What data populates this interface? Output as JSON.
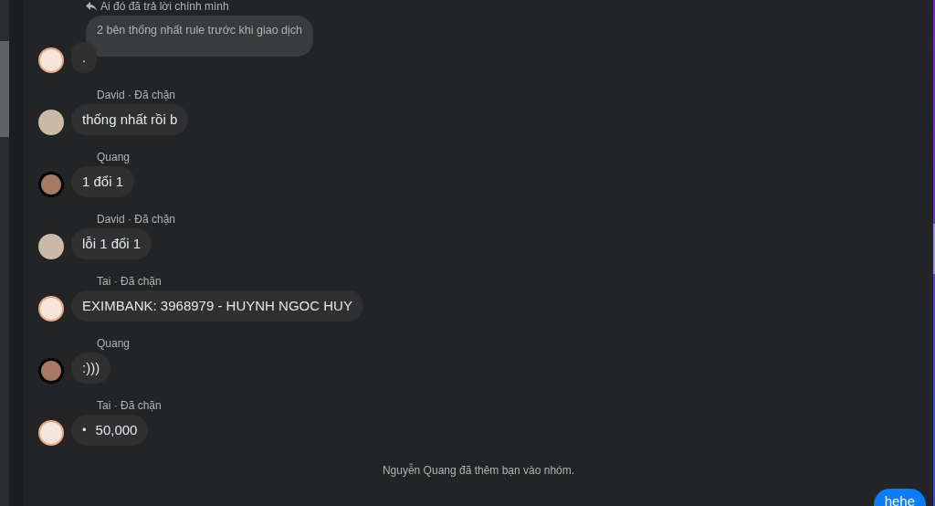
{
  "messages": [
    {
      "reply": {
        "label": "Ai đó đã trả lời chính mình",
        "quote": "2 bên thống nhất rule trước khi giao dịch"
      },
      "text": ".",
      "kind": "cartoon"
    },
    {
      "sender": "David · Đã chặn",
      "text": "thống nhất rồi b",
      "kind": "photo"
    },
    {
      "sender": "Quang",
      "text": "1 đổi 1",
      "kind": "ringed"
    },
    {
      "sender": "David · Đã chặn",
      "text": "lỗi 1 đổi 1",
      "kind": "photo"
    },
    {
      "sender": "Tai · Đã chặn",
      "text": "EXIMBANK: 3968979 - HUYNH NGOC HUY",
      "kind": "cartoon"
    },
    {
      "sender": "Quang",
      "text": ":)))",
      "kind": "ringed"
    },
    {
      "sender": "Tai · Đã chặn",
      "bullet": "•",
      "text": "50,000",
      "kind": "cartoon"
    }
  ],
  "system_message": "Nguyễn Quang đã thêm bạn vào nhóm.",
  "own_message": {
    "text": "hehe"
  }
}
